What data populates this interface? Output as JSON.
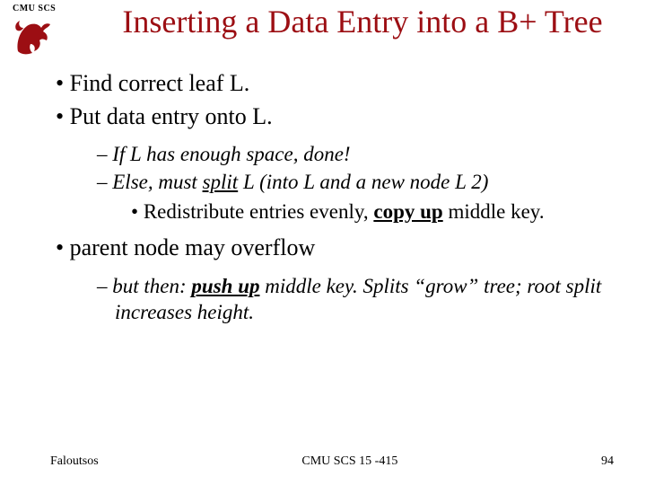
{
  "header": {
    "org_label": "CMU SCS",
    "title": "Inserting a Data Entry into a B+ Tree"
  },
  "bullets": {
    "b1": "Find correct leaf L.",
    "b2": "Put data entry onto L.",
    "b2_1_pre": "If L has enough space, ",
    "b2_1_done": "done",
    "b2_1_post": "!",
    "b2_2_pre": "Else, must ",
    "b2_2_split": "split",
    "b2_2_post": "  L (into L and a new node L 2)",
    "b2_2_1_pre": "Redistribute entries evenly, ",
    "b2_2_1_copy": "copy up",
    "b2_2_1_post": " middle key.",
    "b3": "parent node may overflow",
    "b3_1_pre": "but then: ",
    "b3_1_push": "push up",
    "b3_1_post": " middle key. Splits “grow” tree; root split increases height."
  },
  "footer": {
    "left": "Faloutsos",
    "center": "CMU SCS 15 -415",
    "right": "94"
  },
  "colors": {
    "title": "#9c0e13",
    "logo": "#9c0e13"
  }
}
